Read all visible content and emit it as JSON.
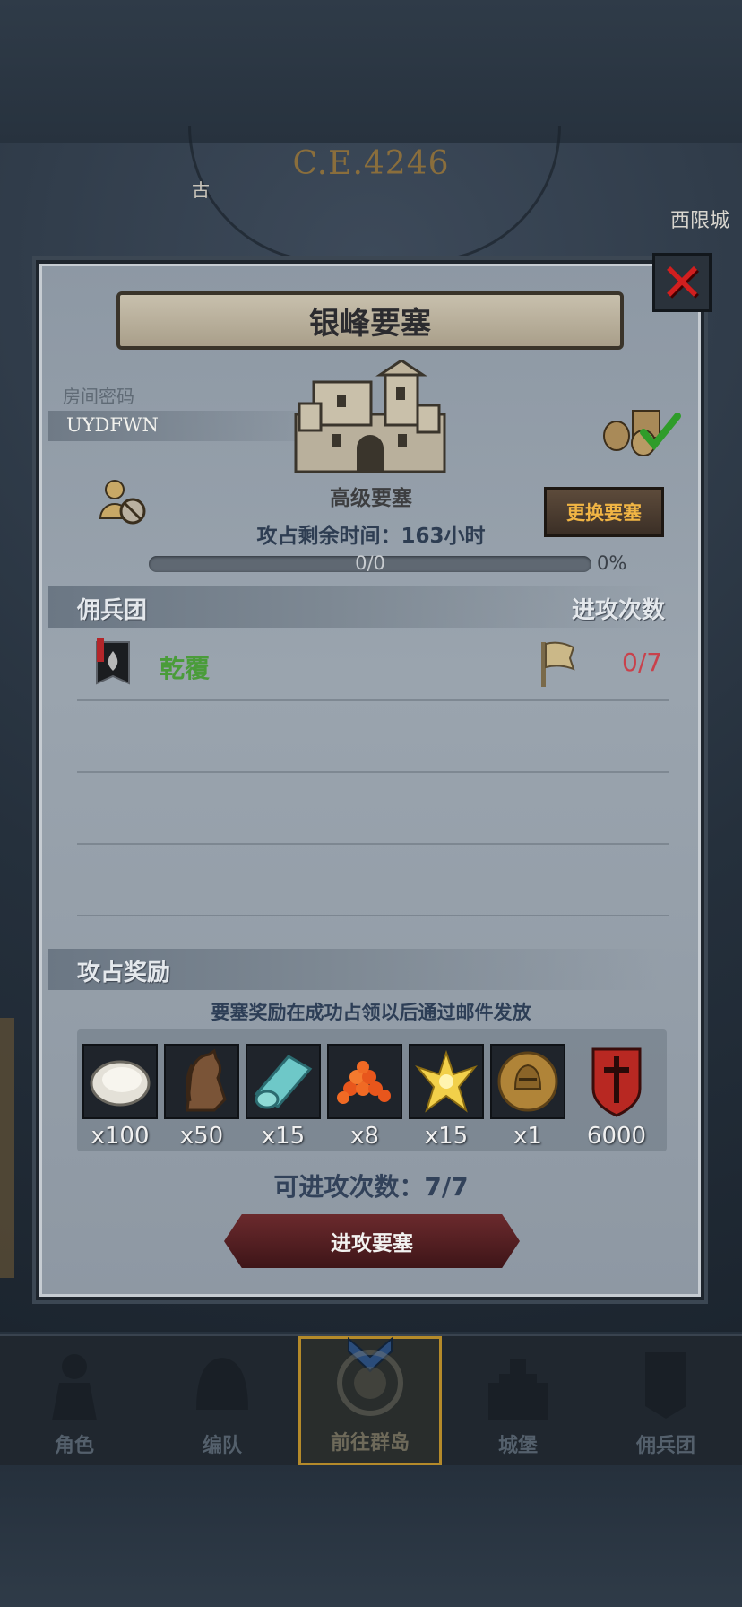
{
  "background": {
    "era": "C.E.4246",
    "map_labels": [
      "西限城",
      "古"
    ]
  },
  "modal": {
    "title": "银峰要塞",
    "room_label": "房间密码",
    "room_code": "UYDFWN",
    "fortress_level": "高级要塞",
    "change_button": "更换要塞",
    "time_left": "攻占剩余时间：163小时",
    "progress": {
      "text": "0/0",
      "percent_text": "0%",
      "fraction": 0
    },
    "mercenary_header": "佣兵团",
    "attack_count_header": "进攻次数",
    "mercenary_rows": [
      {
        "name": "乾覆",
        "attacks": "0/7"
      }
    ],
    "rewards_header": "攻占奖励",
    "rewards_note": "要塞奖励在成功占领以后通过邮件发放",
    "rewards": [
      {
        "icon": "oyster-icon",
        "qty": "x100"
      },
      {
        "icon": "horse-icon",
        "qty": "x50"
      },
      {
        "icon": "cloth-roll-icon",
        "qty": "x15"
      },
      {
        "icon": "orange-beads-icon",
        "qty": "x8"
      },
      {
        "icon": "golden-crest-icon",
        "qty": "x15"
      },
      {
        "icon": "knight-medal-icon",
        "qty": "x1"
      },
      {
        "icon": "sword-shield-icon",
        "qty": "6000"
      }
    ],
    "remaining_attacks": "可进攻次数：7/7",
    "attack_button": "进攻要塞"
  },
  "bottom_nav": [
    {
      "label": "角色",
      "icon": "knight-icon"
    },
    {
      "label": "编队",
      "icon": "helmet-icon"
    },
    {
      "label": "前往群岛",
      "icon": "compass-icon",
      "active": true
    },
    {
      "label": "城堡",
      "icon": "castle-icon"
    },
    {
      "label": "佣兵团",
      "icon": "banner-icon"
    }
  ],
  "colors": {
    "accent_gold": "#f1b544",
    "alert_red": "#c9414b",
    "name_green": "#4a9c3a",
    "close_red": "#d11f1f"
  }
}
